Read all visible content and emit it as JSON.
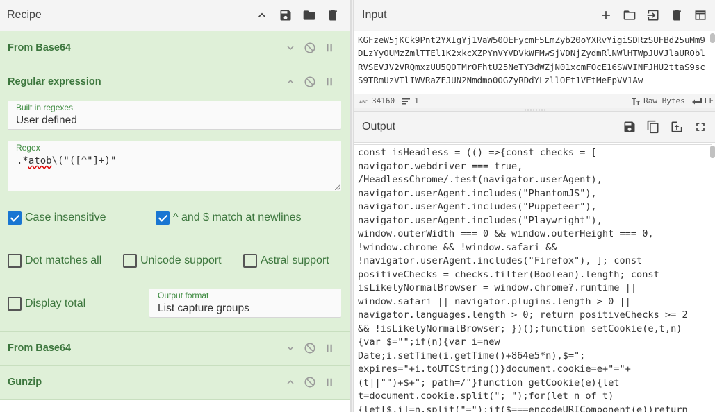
{
  "recipe": {
    "title": "Recipe",
    "operations": [
      {
        "name": "From Base64"
      },
      {
        "name": "Regular expression",
        "builtin_label": "Built in regexes",
        "builtin_value": "User defined",
        "regex_label": "Regex",
        "regex_prefix": ".*",
        "regex_misspelled": "atob",
        "regex_suffix": "\\(\"([^\"]+)\"",
        "checkboxes": [
          {
            "label": "Case insensitive",
            "checked": true
          },
          {
            "label": "^ and $ match at newlines",
            "checked": true
          },
          {
            "label": "Dot matches all",
            "checked": false
          },
          {
            "label": "Unicode support",
            "checked": false
          },
          {
            "label": "Astral support",
            "checked": false
          },
          {
            "label": "Display total",
            "checked": false
          }
        ],
        "output_format_label": "Output format",
        "output_format_value": "List capture groups"
      },
      {
        "name": "From Base64"
      },
      {
        "name": "Gunzip"
      }
    ]
  },
  "input": {
    "title": "Input",
    "text": "KGFzeW5jKCk9Pnt2YXIgYj1VaW50OEFycmF5LmZyb20oYXRvYigiSDRzSUFBd25uMm9DLzYyOUMzZmlTTEl1K2xkcXZPYnVYVDVkWFMwSjVDNjZydmRlNWlHTWpJUVJlaUROblRVSEVJV2VRQmxzUU5QOTMrOFhtU25NeTY3dWZjN01xcmFOcE16SWVINFJHU2ttaS9scS9TRmUzVTlIWVRaZFJUN2Nmdmo0OGZyRDdYLzllOFt1VEtMeFpVV1Aw",
    "char_count": "34160",
    "line_count": "1",
    "encoding": "Raw Bytes",
    "line_ending": "LF"
  },
  "output": {
    "title": "Output",
    "lines": [
      "const isHeadless = (() =>{const checks = [",
      "navigator.webdriver === true,",
      "/HeadlessChrome/.test(navigator.userAgent),",
      "navigator.userAgent.includes(\"PhantomJS\"),",
      "navigator.userAgent.includes(\"Puppeteer\"),",
      "navigator.userAgent.includes(\"Playwright\"),",
      "window.outerWidth === 0 && window.outerHeight === 0,",
      "!window.chrome && !window.safari &&",
      "!navigator.userAgent.includes(\"Firefox\"), ]; const",
      "positiveChecks = checks.filter(Boolean).length; const",
      "isLikelyNormalBrowser = window.chrome?.runtime ||",
      "window.safari || navigator.plugins.length > 0 ||",
      "navigator.languages.length > 0; return positiveChecks >= 2",
      "&& !isLikelyNormalBrowser; })();function setCookie(e,t,n)",
      "{var $=\"\";if(n){var i=new",
      "Date;i.setTime(i.getTime()+864e5*n),$=\";",
      "expires=\"+i.toUTCString()}document.cookie=e+\"=\"+",
      "(t||\"\")+$+\"; path=/\"}function getCookie(e){let",
      "t=document.cookie.split(\"; \");for(let n of t)",
      "{let[$,i]=n.split(\"=\");if($===encodeURIComponent(e))return"
    ]
  }
}
